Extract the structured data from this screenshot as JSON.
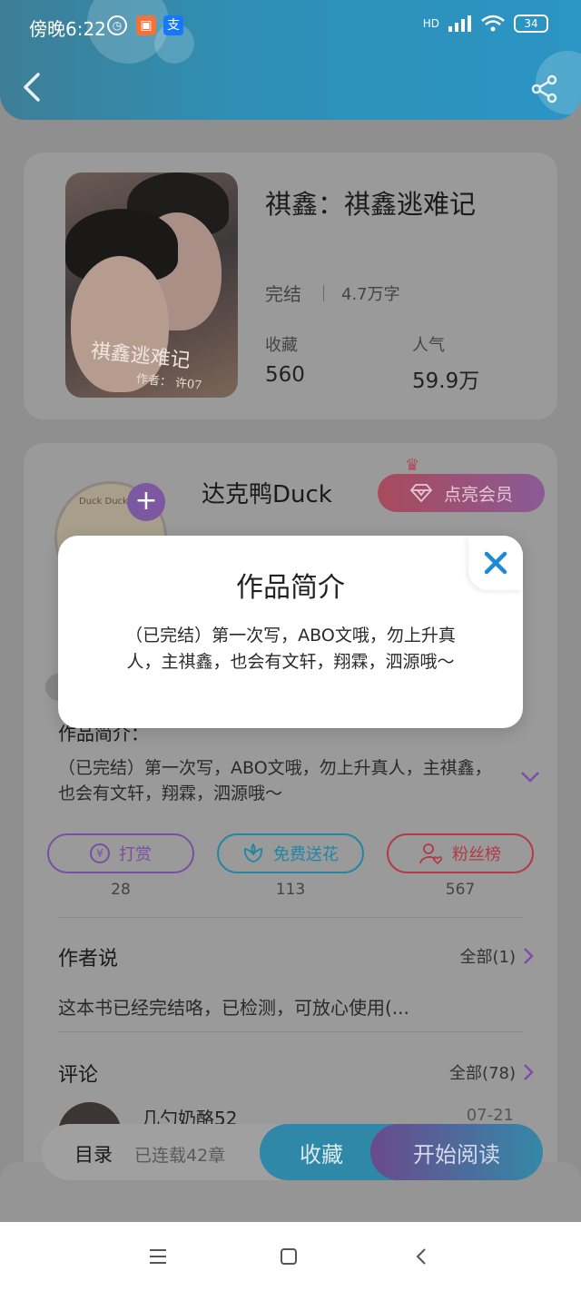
{
  "status_bar": {
    "time": "傍晚6:22",
    "battery": "34",
    "network": "HD"
  },
  "book": {
    "title": "祺鑫：祺鑫逃难记",
    "cover_title": "祺鑫逃难记",
    "cover_author": "作者：  许07",
    "status": "完结",
    "word_count": "4.7万字",
    "favorites_label": "收藏",
    "favorites_value": "560",
    "popularity_label": "人气",
    "popularity_value": "59.9万"
  },
  "author": {
    "name": "达克鸭Duck",
    "avatar_text": "Duck Duck",
    "vip_label": "点亮会员"
  },
  "intro": {
    "label": "作品简介：",
    "text": "（已完结）第一次写，ABO文哦，勿上升真人，主祺鑫，也会有文轩，翔霖，泗源哦～"
  },
  "actions": [
    {
      "label": "打赏",
      "count": "28",
      "color": "#7a4fa3"
    },
    {
      "label": "免费送花",
      "count": "113",
      "color": "#1f86a6"
    },
    {
      "label": "粉丝榜",
      "count": "567",
      "color": "#b23a46"
    }
  ],
  "author_says": {
    "title": "作者说",
    "all_label": "全部(1)",
    "text": "这本书已经完结咯，已检测，可放心使用(..."
  },
  "comments": {
    "title": "评论",
    "all_label": "全部(78)",
    "first_user": "几勺奶酪52",
    "first_date": "07-21"
  },
  "bottom_bar": {
    "toc_label": "目录",
    "chapters": "已连载42章",
    "collect_label": "收藏",
    "read_label": "开始阅读"
  },
  "modal": {
    "title": "作品简介",
    "body": "（已完结）第一次写，ABO文哦，勿上升真人，主祺鑫，也会有文轩，翔霖，泗源哦～"
  }
}
